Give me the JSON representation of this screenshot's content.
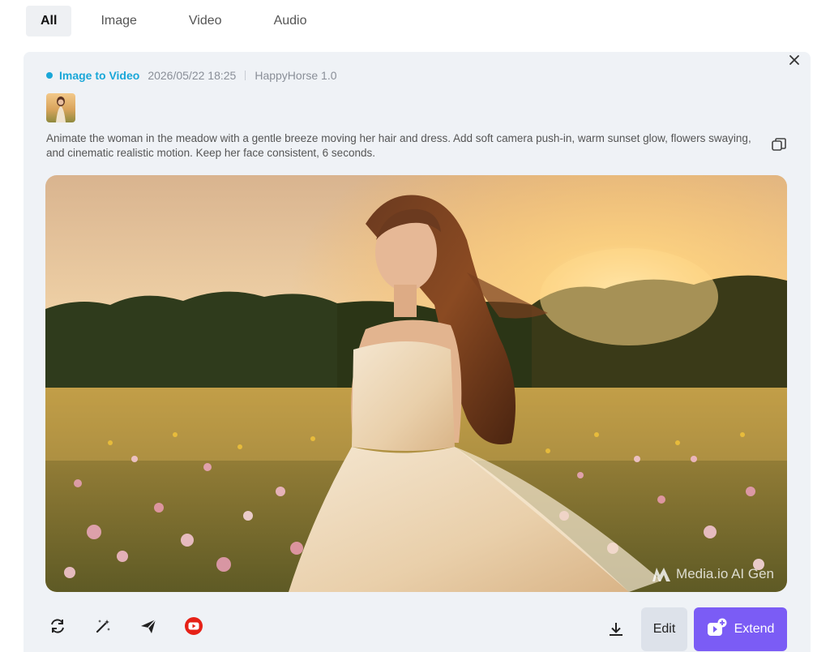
{
  "tabs": [
    {
      "label": "All",
      "active": true
    },
    {
      "label": "Image",
      "active": false
    },
    {
      "label": "Video",
      "active": false
    },
    {
      "label": "Audio",
      "active": false
    }
  ],
  "task": {
    "type": "Image to Video",
    "date": "2026/05/22 18:25",
    "model": "HappyHorse 1.0",
    "prompt": "Animate the woman in the meadow with a gentle breeze moving her hair and dress. Add soft camera push-in, warm sunset glow, flowers swaying, and cinematic realistic motion. Keep her face consistent, 6 seconds."
  },
  "media": {
    "watermark": "Media.io AI Gen"
  },
  "actions": {
    "edit_label": "Edit",
    "extend_label": "Extend"
  },
  "icons": {
    "close": "close-icon",
    "copy": "copy-icon",
    "regenerate": "refresh-icon",
    "enhance": "magic-wand-icon",
    "share": "send-icon",
    "youtube": "youtube-icon",
    "download": "download-icon",
    "extend": "video-plus-icon"
  },
  "colors": {
    "accent": "#1aa7d8",
    "extend_button": "#7b5cf5",
    "youtube": "#e62117"
  }
}
